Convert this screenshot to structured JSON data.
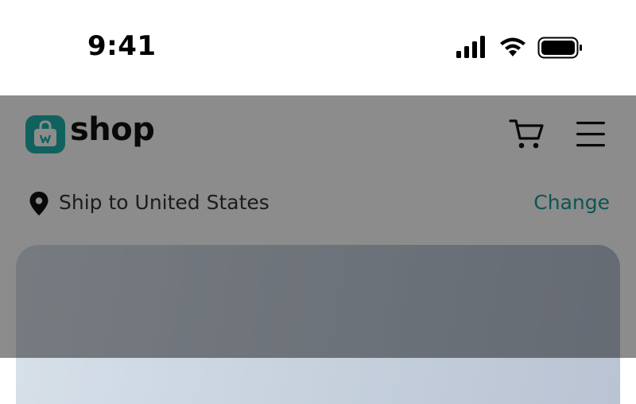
{
  "status_bar": {
    "time": "9:41",
    "icons": [
      "cellular-signal-icon",
      "wifi-icon",
      "battery-icon"
    ]
  },
  "header": {
    "logo_text": "shop",
    "logo_icon": "shopping-bag-icon",
    "cart_icon": "cart-icon",
    "menu_icon": "hamburger-menu-icon"
  },
  "shipping": {
    "icon": "location-pin-icon",
    "label": "Ship to United States",
    "change_label": "Change"
  },
  "colors": {
    "brand": "#1fb3ad",
    "link": "#1a9c97",
    "overlay": "rgba(0,0,0,0.45)"
  }
}
